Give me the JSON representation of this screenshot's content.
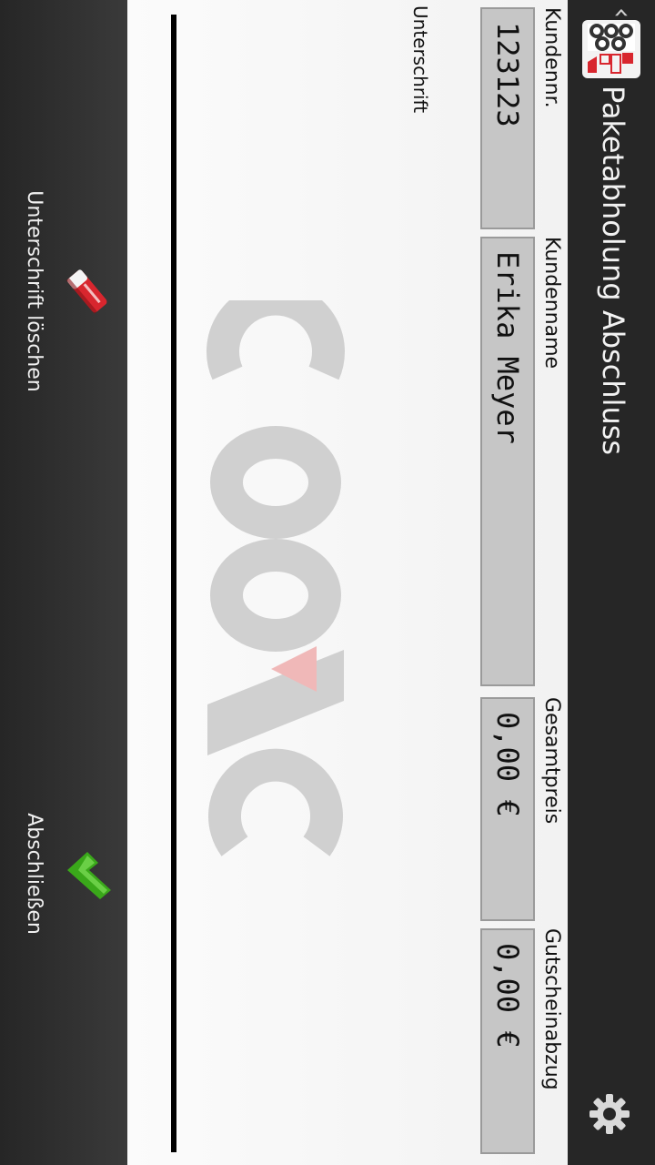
{
  "header": {
    "title": "Paketabholung Abschluss",
    "logo_icon": "coss-logo-icon",
    "settings_icon": "gear-icon"
  },
  "fields": {
    "customer_number": {
      "label": "Kundennr.",
      "value": "123123"
    },
    "customer_name": {
      "label": "Kundenname",
      "value": "Erika Meyer"
    },
    "total_price": {
      "label": "Gesamtpreis",
      "value": "0,00 €"
    },
    "voucher_deduction": {
      "label": "Gutscheinabzug",
      "value": "0,00 €"
    }
  },
  "signature": {
    "label": "Unterschrift"
  },
  "actions": {
    "clear_signature": {
      "label": "Unterschrift löschen",
      "icon": "eraser-icon"
    },
    "finish": {
      "label": "Abschließen",
      "icon": "checkmark-icon"
    }
  },
  "colors": {
    "actionbar": "#262626",
    "field_box": "#c6c6c6",
    "accent_green": "#3aa81a",
    "accent_red": "#d8262e"
  }
}
